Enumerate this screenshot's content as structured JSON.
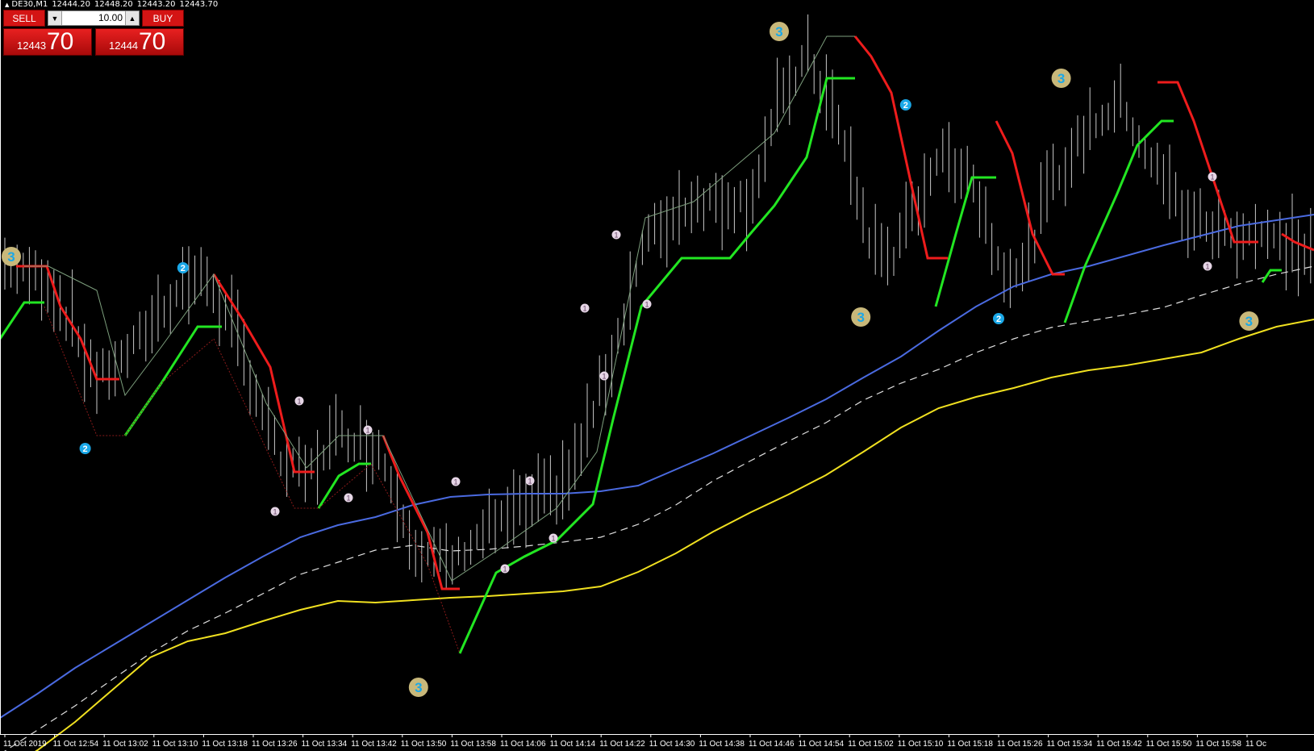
{
  "header": {
    "symbol": "DE30,M1",
    "open": "12444.20",
    "high": "12448.20",
    "low": "12443.20",
    "close": "12443.70"
  },
  "trade_panel": {
    "sell_label": "SELL",
    "buy_label": "BUY",
    "lot_value": "10.00",
    "sell_price_small": "12443",
    "sell_price_big": "70",
    "buy_price_small": "12444",
    "buy_price_big": "70"
  },
  "colors": {
    "background": "#000000",
    "bars": "#c8c8c8",
    "support_green": "#22e622",
    "resistance_red": "#ee1c1c",
    "ema_blue": "#4a6ae0",
    "ema_white_dashed": "#e0e0e0",
    "ema_yellow": "#f0e020",
    "marker_gold": "#c8b87a",
    "marker_cyan": "#1aa8e8",
    "marker_pink": "#e6d6e6"
  },
  "chart_data": {
    "type": "line",
    "symbol": "DE30,M1",
    "x_tick_labels": [
      "11 Oct 2019",
      "11 Oct 12:54",
      "11 Oct 13:02",
      "11 Oct 13:10",
      "11 Oct 13:18",
      "11 Oct 13:26",
      "11 Oct 13:34",
      "11 Oct 13:42",
      "11 Oct 13:50",
      "11 Oct 13:58",
      "11 Oct 14:06",
      "11 Oct 14:14",
      "11 Oct 14:22",
      "11 Oct 14:30",
      "11 Oct 14:38",
      "11 Oct 14:46",
      "11 Oct 14:54",
      "11 Oct 15:02",
      "11 Oct 15:10",
      "11 Oct 15:18",
      "11 Oct 15:26",
      "11 Oct 15:34",
      "11 Oct 15:42",
      "11 Oct 15:50",
      "11 Oct 15:58",
      "11 Oc"
    ],
    "y_axis_visible": false,
    "grid": false,
    "price_chart_note": "bars with trend-stop overlay, 3 moving averages and swing markers",
    "series": [
      {
        "style": "solid",
        "color": "#4a6ae0",
        "values": [
          890,
          860,
          828,
          800,
          772,
          744,
          716,
          690,
          666,
          651,
          641,
          626,
          616,
          613,
          612,
          612,
          609,
          602,
          582,
          562,
          540,
          518,
          495,
          468,
          442,
          410,
          380,
          355,
          340,
          330,
          317,
          304,
          292,
          280,
          273,
          266
        ]
      },
      {
        "style": "dashed",
        "color": "#e0e0e0",
        "values": [
          935,
          905,
          875,
          842,
          810,
          782,
          760,
          736,
          712,
          697,
          682,
          676,
          683,
          681,
          677,
          672,
          666,
          650,
          626,
          596,
          571,
          547,
          524,
          496,
          475,
          458,
          437,
          420,
          406,
          398,
          390,
          381,
          366,
          352,
          340,
          330
        ]
      },
      {
        "style": "solid",
        "color": "#f0e020",
        "values": [
          960,
          930,
          895,
          855,
          815,
          795,
          785,
          770,
          756,
          745,
          747,
          744,
          741,
          739,
          736,
          733,
          727,
          709,
          686,
          659,
          635,
          613,
          589,
          560,
          530,
          506,
          492,
          481,
          468,
          459,
          453,
          445,
          437,
          420,
          405,
          396
        ]
      }
    ],
    "markers": [
      {
        "kind": "gold",
        "label": "3",
        "x_tick": "11 Oct 2019",
        "price_level": 318
      },
      {
        "kind": "cyan",
        "label": "2",
        "x_tick": "11 Oct 12:54",
        "price_level": 556
      },
      {
        "kind": "cyan",
        "label": "2",
        "x_tick": "11 Oct 13:10",
        "price_level": 332
      },
      {
        "kind": "gold",
        "label": "3",
        "x_tick": "11 Oct 13:50",
        "price_level": 852
      },
      {
        "kind": "gold",
        "label": "3",
        "x_tick": "11 Oct 14:46",
        "price_level": 39
      },
      {
        "kind": "gold",
        "label": "3",
        "x_tick": "11 Oct 15:02",
        "price_level": 393
      },
      {
        "kind": "cyan",
        "label": "2",
        "x_tick": "11 Oct 15:10",
        "price_level": 130
      },
      {
        "kind": "cyan",
        "label": "2",
        "x_tick": "11 Oct 15:26",
        "price_level": 395
      },
      {
        "kind": "gold",
        "label": "3",
        "x_tick": "11 Oct 15:34",
        "price_level": 97
      },
      {
        "kind": "gold",
        "label": "3",
        "x_tick": "11 Oct 15:58",
        "price_level": 398
      }
    ]
  }
}
